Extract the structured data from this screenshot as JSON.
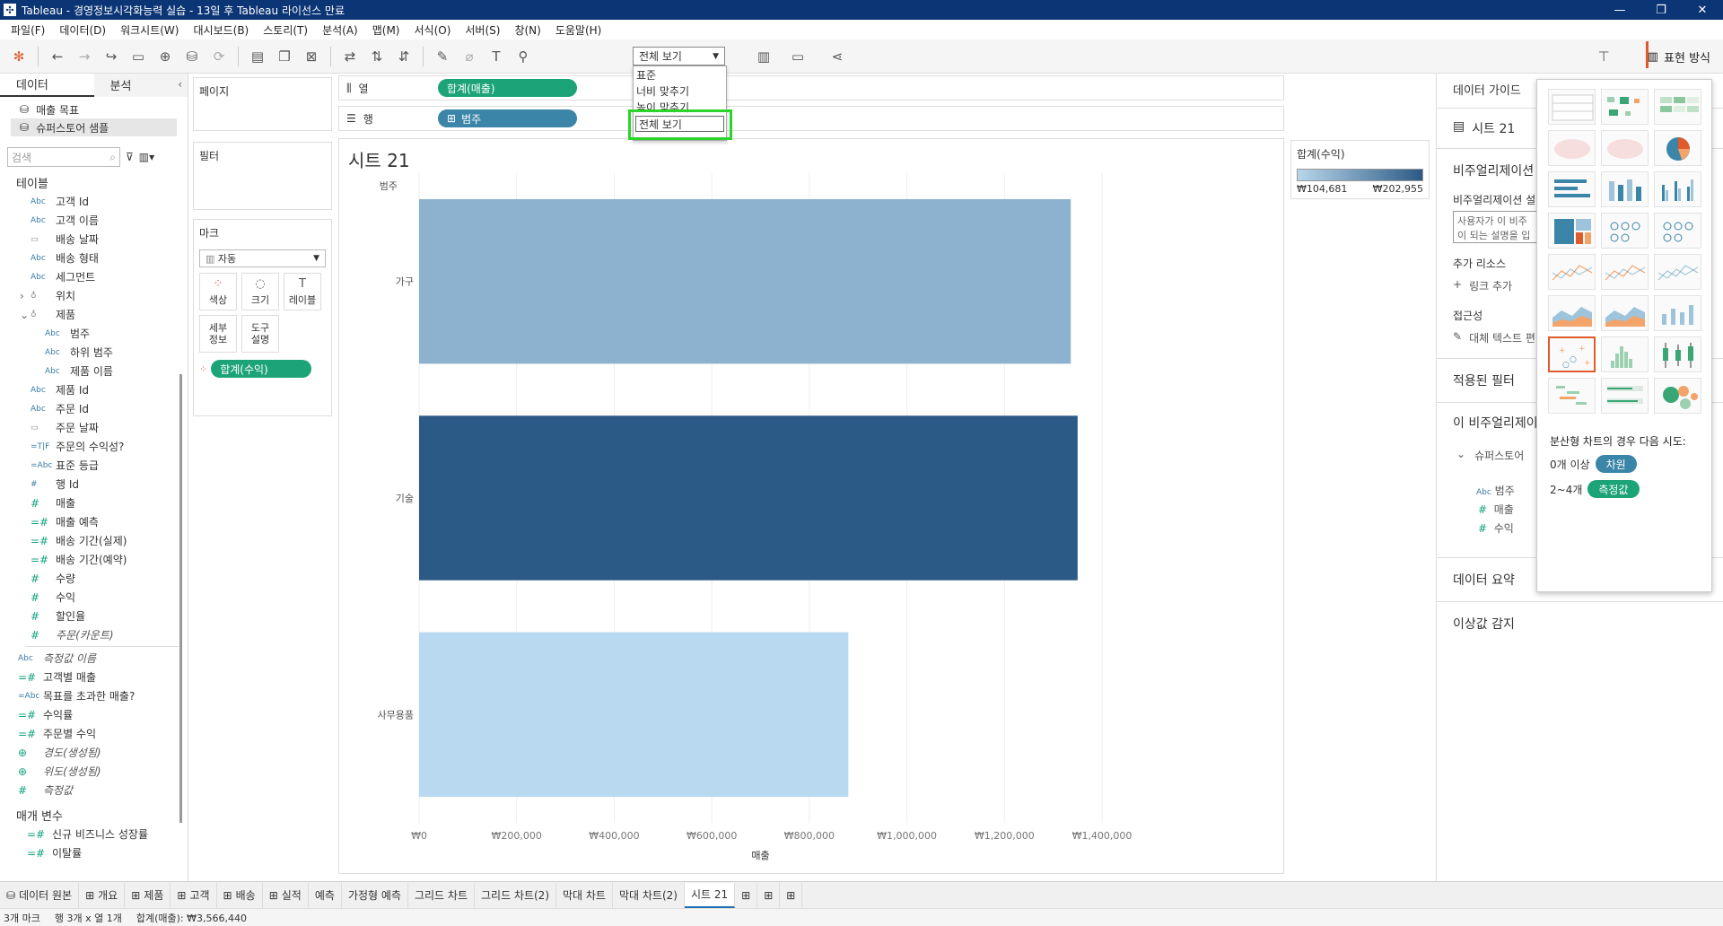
{
  "window": {
    "title": "Tableau - 경영정보시각화능력 실습 - 13일 후 Tableau 라이선스 만료",
    "min": "—",
    "max": "❐",
    "close": "✕"
  },
  "menu": [
    "파일(F)",
    "데이터(D)",
    "워크시트(W)",
    "대시보드(B)",
    "스토리(T)",
    "분석(A)",
    "맵(M)",
    "서식(O)",
    "서버(S)",
    "창(N)",
    "도움말(H)"
  ],
  "toolbar": {
    "fit_value": "전체 보기",
    "show_me_label": "표현 방식"
  },
  "fit_dropdown": {
    "options": [
      "표준",
      "너비 맞추기",
      "높이 맞추기",
      "전체 보기"
    ]
  },
  "data_pane": {
    "tab_data": "데이터",
    "tab_analysis": "분석",
    "sources": [
      "매출 목표",
      "슈퍼스토어 샘플"
    ],
    "search_placeholder": "검색",
    "tables_header": "테이블",
    "fields": [
      {
        "type": "Abc",
        "name": "고객 Id",
        "indent": 1
      },
      {
        "type": "Abc",
        "name": "고객 이름",
        "indent": 1
      },
      {
        "type": "cal",
        "name": "배송 날짜",
        "indent": 1
      },
      {
        "type": "Abc",
        "name": "배송 형태",
        "indent": 1
      },
      {
        "type": "Abc",
        "name": "세그먼트",
        "indent": 1
      },
      {
        "type": "hier",
        "name": "위치",
        "indent": 1,
        "expander": "›"
      },
      {
        "type": "hier",
        "name": "제품",
        "indent": 1,
        "expander": "⌄"
      },
      {
        "type": "Abc",
        "name": "범주",
        "indent": 2
      },
      {
        "type": "Abc",
        "name": "하위 범주",
        "indent": 2
      },
      {
        "type": "Abc",
        "name": "제품 이름",
        "indent": 2
      },
      {
        "type": "Abc",
        "name": "제품 Id",
        "indent": 1
      },
      {
        "type": "Abc",
        "name": "주문 Id",
        "indent": 1
      },
      {
        "type": "cal",
        "name": "주문 날짜",
        "indent": 1
      },
      {
        "type": "=T|F",
        "name": "주문의 수익성?",
        "indent": 1
      },
      {
        "type": "=Abc",
        "name": "표준 등급",
        "indent": 1
      },
      {
        "type": "#",
        "name": "행 Id",
        "indent": 1
      },
      {
        "type": "#",
        "name": "매출",
        "indent": 1,
        "measure": true
      },
      {
        "type": "=#",
        "name": "매출 예측",
        "indent": 1,
        "measure": true
      },
      {
        "type": "=#",
        "name": "배송 기간(실제)",
        "indent": 1,
        "measure": true
      },
      {
        "type": "=#",
        "name": "배송 기간(예약)",
        "indent": 1,
        "measure": true
      },
      {
        "type": "#",
        "name": "수량",
        "indent": 1,
        "measure": true
      },
      {
        "type": "#",
        "name": "수익",
        "indent": 1,
        "measure": true
      },
      {
        "type": "#",
        "name": "할인율",
        "indent": 1,
        "measure": true
      },
      {
        "type": "#",
        "name": "주문(카운트)",
        "indent": 1,
        "measure": true,
        "italic": true
      }
    ],
    "extra_fields": [
      {
        "type": "Abc",
        "name": "측정값 이름",
        "italic": true
      },
      {
        "type": "=#",
        "name": "고객별 매출",
        "measure": true
      },
      {
        "type": "=Abc",
        "name": "목표를 초과한 매출?"
      },
      {
        "type": "=#",
        "name": "수익률",
        "measure": true
      },
      {
        "type": "=#",
        "name": "주문별 수익",
        "measure": true
      },
      {
        "type": "geo",
        "name": "경도(생성됨)",
        "measure": true,
        "italic": true
      },
      {
        "type": "geo",
        "name": "위도(생성됨)",
        "measure": true,
        "italic": true
      },
      {
        "type": "#",
        "name": "측정값",
        "measure": true,
        "italic": true
      }
    ],
    "params_header": "매개 변수",
    "params": [
      "신규 비즈니스 성장률",
      "이탈률"
    ]
  },
  "cards": {
    "pages": "페이지",
    "filters": "필터",
    "marks": "마크",
    "mark_type": "자동",
    "mark_buttons": [
      "색상",
      "크기",
      "레이블",
      "세부\n정보",
      "도구\n설명"
    ],
    "color_pill": "합계(수익)"
  },
  "shelves": {
    "columns_label": "열",
    "rows_label": "행",
    "columns_pill": "합계(매출)",
    "rows_pill": "범주"
  },
  "sheet": {
    "title": "시트 21",
    "row_header": "범주"
  },
  "chart_data": {
    "type": "bar",
    "orientation": "horizontal",
    "categories": [
      "가구",
      "기술",
      "사무용품"
    ],
    "values": [
      1336000,
      1350000,
      880000
    ],
    "color_values": [
      135000,
      202955,
      104681
    ],
    "xlabel": "매출",
    "ylabel": "범주",
    "xlim": [
      0,
      1400000
    ],
    "xticks": [
      0,
      200000,
      400000,
      600000,
      800000,
      1000000,
      1200000,
      1400000
    ],
    "xtick_labels": [
      "₩0",
      "₩200,000",
      "₩400,000",
      "₩600,000",
      "₩800,000",
      "₩1,000,000",
      "₩1,200,000",
      "₩1,400,000"
    ],
    "grid": true,
    "color_low": "#b8d9ef",
    "color_high": "#2c5a86"
  },
  "legend": {
    "title": "합계(수익)",
    "min": "₩104,681",
    "max": "₩202,955"
  },
  "data_guide": {
    "title": "데이터 가이드",
    "sheet": "시트 21",
    "viz_desc": "비주얼리제이션",
    "viz_desc_sub": "비주얼리제이션 설",
    "desc_text1": "사용자가 이 비주",
    "desc_text2": "이 되는 설명을 입",
    "resources": "추가 리소스",
    "add_link": "링크 추가",
    "accessibility": "접근성",
    "alt_text": "대체 텍스트 편",
    "applied_filters": "적용된 필터",
    "this_viz": "이 비주얼리제이",
    "source": "슈퍼스토어",
    "fields": [
      {
        "type": "Abc",
        "name": "범주"
      },
      {
        "type": "#",
        "name": "매출"
      },
      {
        "type": "#",
        "name": "수익"
      }
    ],
    "data_summary": "데이터 요약",
    "outliers": "이상값 감지"
  },
  "show_me": {
    "hint": "분산형 차트의 경우 다음 시도:",
    "row1_label": "0개 이상",
    "row1_badge": "차원",
    "row2_label": "2~4개",
    "row2_badge": "측정값"
  },
  "sheet_tabs": [
    "데이터 원본",
    "개요",
    "제품",
    "고객",
    "배송",
    "실적",
    "예측",
    "가정형 예측",
    "그리드 차트",
    "그리드 차트(2)",
    "막대 차트",
    "막대 차트(2)",
    "시트 21"
  ],
  "status": {
    "marks": "3개 마크",
    "rows_cols": "행 3개 x 열 1개",
    "sum": "합계(매출): ₩3,566,440"
  }
}
